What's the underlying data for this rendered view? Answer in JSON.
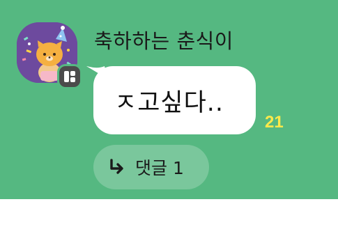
{
  "message": {
    "sender_name": "축하하는 춘식이",
    "text": "ㅈ고싶다..",
    "unread_count": "21",
    "reply_label": "댓글 1"
  },
  "icons": {
    "avatar": "party-cat-avatar",
    "badge": "app-badge-icon",
    "reply": "reply-arrow-icon"
  },
  "colors": {
    "chat_background": "#55b881",
    "bubble": "#ffffff",
    "unread_count": "#ffe94a",
    "avatar_background": "#6d4a9e"
  }
}
